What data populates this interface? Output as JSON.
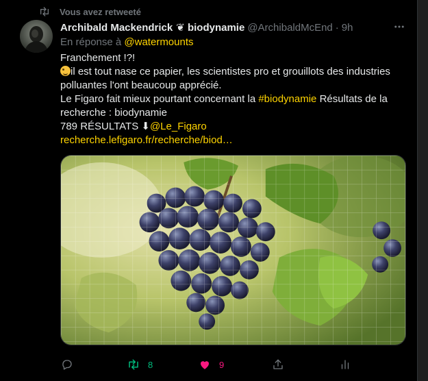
{
  "retweet_notice": "Vous avez retweeté",
  "author": {
    "name": "Archibald Mackendrick",
    "name_suffix": "❦ biodynamie",
    "handle": "@ArchibaldMcEnd",
    "separator": "·",
    "time": "9h"
  },
  "reply": {
    "prefix": "En réponse à",
    "target": "@watermounts"
  },
  "text": {
    "line1": "Franchement !?!",
    "line2": "il est tout nase ce papier, les scientistes pro et grouillots des industries polluantes l'ont beaucoup apprécié.",
    "line3_before": "Le Figaro fait mieux pourtant concernant la ",
    "line3_hashtag": "#biodynamie",
    "line3_after": " Résultats de la recherche : biodynamie",
    "line4_before": "789 RÉSULTATS ⬇",
    "line4_mention": "@Le_Figaro",
    "link": "recherche.lefigaro.fr/recherche/biod…"
  },
  "media": {
    "icon": "grape-photo"
  },
  "actions": {
    "reply_count": "",
    "retweet_count": "8",
    "like_count": "9"
  },
  "colors": {
    "accent": "#ffd400",
    "retweet": "#00ba7c",
    "like": "#f91880",
    "muted": "#71767b"
  }
}
